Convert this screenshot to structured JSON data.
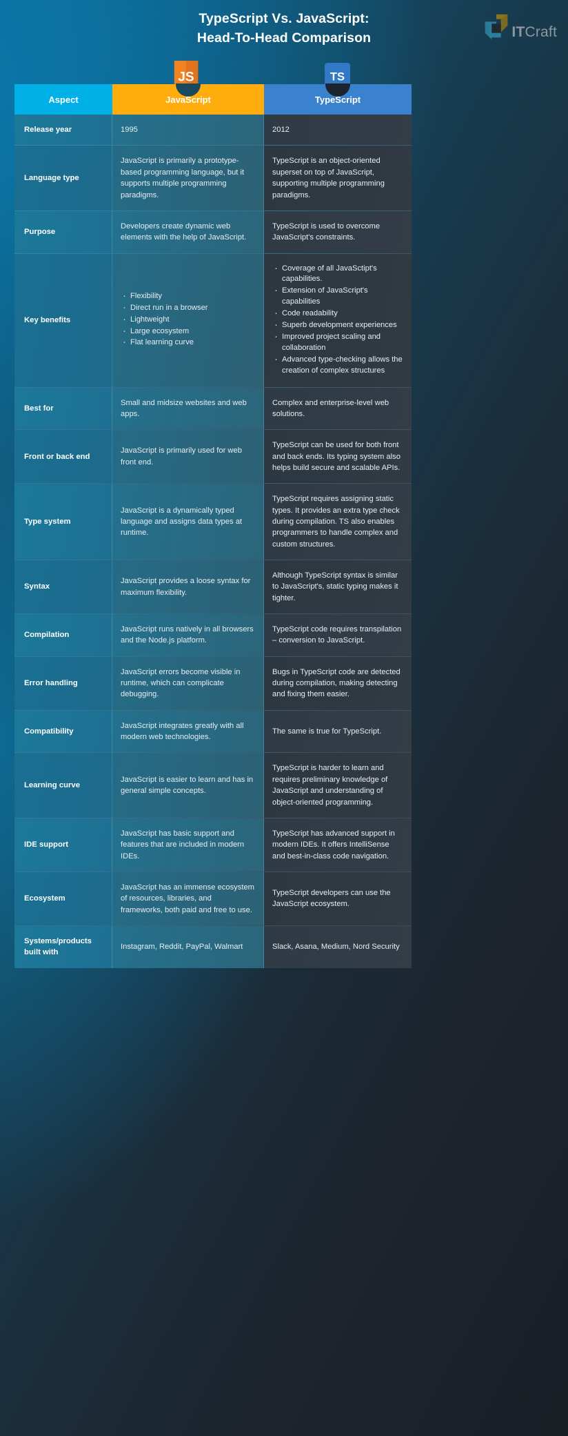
{
  "header": {
    "title_line1": "TypeScript Vs. JavaScript:",
    "title_line2": "Head-To-Head Comparison",
    "logo": {
      "name": "it-craft-logo",
      "text_it": "IT",
      "text_craft": "Craft",
      "color_teal": "#2b7f9e",
      "color_gold": "#8a7320"
    }
  },
  "badges": {
    "javascript": {
      "label": "JS",
      "color": "#f0821f"
    },
    "typescript": {
      "label": "TS",
      "color": "#3178c6"
    }
  },
  "table": {
    "columns": [
      {
        "label": "Aspect",
        "color": "#00b0e6"
      },
      {
        "label": "JavaScript",
        "color": "#ffad0d"
      },
      {
        "label": "TypeScript",
        "color": "#3b82ce"
      }
    ],
    "rows": [
      {
        "aspect": "Release year",
        "javascript": "1995",
        "typescript": "2012"
      },
      {
        "aspect": "Language type",
        "javascript": "JavaScript is primarily a prototype-based programming language, but it supports multiple programming paradigms.",
        "typescript": "TypeScript is an object-oriented superset on top of JavaScript, supporting multiple programming paradigms."
      },
      {
        "aspect": "Purpose",
        "javascript": "Developers create dynamic web elements with the help of JavaScript.",
        "typescript": "TypeScript is used to overcome JavaScript's constraints."
      },
      {
        "aspect": "Key benefits",
        "javascript_bullets": [
          "Flexibility",
          "Direct run in a browser",
          "Lightweight",
          "Large ecosystem",
          "Flat learning curve"
        ],
        "typescript_bullets": [
          "Coverage of all JavaSctipt's capabilities.",
          "Extension of JavaScript's capabilities",
          "Code readability",
          "Superb development experiences",
          "Improved project scaling and collaboration",
          "Advanced type-checking allows the creation of complex structures"
        ]
      },
      {
        "aspect": "Best for",
        "javascript": "Small and midsize websites and web apps.",
        "typescript": "Complex and enterprise-level web solutions."
      },
      {
        "aspect": "Front or back end",
        "javascript": "JavaScript is primarily used for web front end.",
        "typescript": "TypeScript can be used for both front and back ends. Its typing system also helps build secure and scalable APIs."
      },
      {
        "aspect": "Type system",
        "javascript": "JavaScript is a dynamically typed language and assigns data types at runtime.",
        "typescript": "TypeScript requires assigning static types. It provides an extra type check during compilation. TS also enables programmers to handle complex and custom structures."
      },
      {
        "aspect": "Syntax",
        "javascript": "JavaScript provides a loose syntax for maximum flexibility.",
        "typescript": "Although TypeScript syntax is similar to JavaScript's, static typing makes it tighter."
      },
      {
        "aspect": "Compilation",
        "javascript": "JavaScript runs natively in all browsers and the Node.js platform.",
        "typescript": "TypeScript code requires transpilation – conversion to JavaScript."
      },
      {
        "aspect": "Error handling",
        "javascript": "JavaScript errors become visible in runtime, which can complicate debugging.",
        "typescript": "Bugs in TypeScript code are detected during compilation, making detecting and fixing them easier."
      },
      {
        "aspect": "Compatibility",
        "javascript": "JavaScript integrates greatly with all modern web technologies.",
        "typescript": "The same is true for TypeScript."
      },
      {
        "aspect": "Learning curve",
        "javascript": "JavaScript is easier to learn and has in general simple concepts.",
        "typescript": "TypeScript is harder to learn and requires preliminary knowledge of JavaScript and understanding of object-oriented programming."
      },
      {
        "aspect": "IDE support",
        "javascript": "JavaScript has basic support and features that are included in modern IDEs.",
        "typescript": "TypeScript has advanced support in modern IDEs. It offers IntelliSense and best-in-class code navigation."
      },
      {
        "aspect": "Ecosystem",
        "javascript": "JavaScript has an immense ecosystem of resources, libraries, and frameworks, both paid and free to use.",
        "typescript": "TypeScript developers can use the JavaScript ecosystem."
      },
      {
        "aspect": "Systems/products built with",
        "javascript": "Instagram, Reddit, PayPal, Walmart",
        "typescript": "Slack, Asana, Medium, Nord Security"
      }
    ]
  }
}
